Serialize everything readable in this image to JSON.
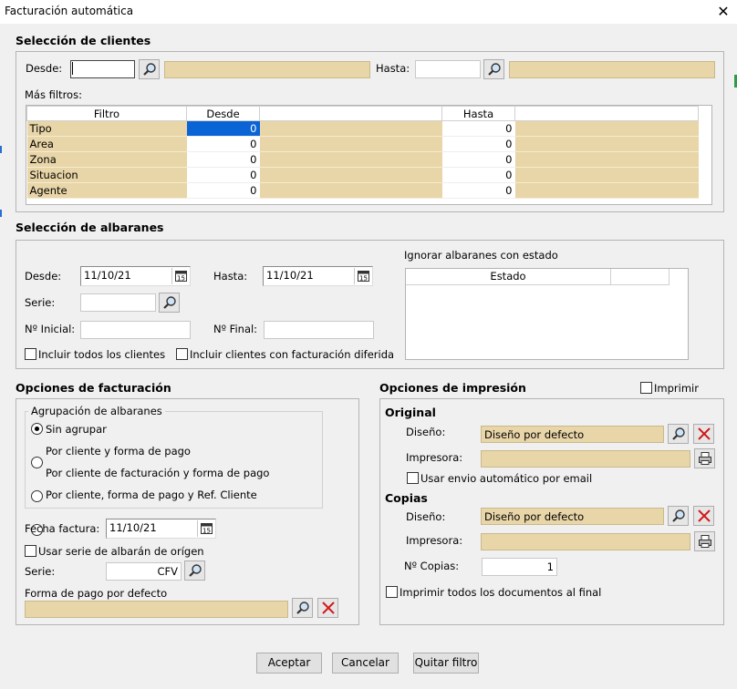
{
  "window": {
    "title": "Facturación automática",
    "close": "✕"
  },
  "clientes": {
    "title": "Selección de clientes",
    "desde_label": "Desde:",
    "hasta_label": "Hasta:",
    "desde_value": "",
    "hasta_value": "",
    "desde_name": "",
    "hasta_name": "",
    "mas_filtros": "Más filtros:",
    "columns": [
      "Filtro",
      "Desde",
      "",
      "Hasta",
      ""
    ],
    "rows": [
      {
        "filtro": "Tipo",
        "desde": "0",
        "hasta": "0"
      },
      {
        "filtro": "Area",
        "desde": "0",
        "hasta": "0"
      },
      {
        "filtro": "Zona",
        "desde": "0",
        "hasta": "0"
      },
      {
        "filtro": "Situacion",
        "desde": "0",
        "hasta": "0"
      },
      {
        "filtro": "Agente",
        "desde": "0",
        "hasta": "0"
      }
    ]
  },
  "albaranes": {
    "title": "Selección de albaranes",
    "desde_label": "Desde:",
    "desde_value": "11/10/21",
    "hasta_label": "Hasta:",
    "hasta_value": "11/10/21",
    "serie_label": "Serie:",
    "serie_value": "",
    "ninicial_label": "Nº Inicial:",
    "ninicial_value": "",
    "nfinal_label": "Nº Final:",
    "nfinal_value": "",
    "incluir_todos": "Incluir todos los clientes",
    "incluir_diferida": "Incluir clientes con facturación diferida",
    "ignorar_label": "Ignorar albaranes con estado",
    "estado_col": "Estado"
  },
  "facturacion": {
    "title": "Opciones de facturación",
    "agrupacion_label": "Agrupación de albaranes",
    "options": [
      "Sin agrupar",
      "Por cliente y forma de pago",
      "Por cliente de facturación y forma de pago",
      "Por cliente, forma de pago y Ref. Cliente"
    ],
    "selected_index": 0,
    "fecha_label": "Fecha factura:",
    "fecha_value": "11/10/21",
    "usar_serie": "Usar serie de albarán de orígen",
    "serie_label": "Serie:",
    "serie_value": "CFV",
    "forma_pago_label": "Forma de pago por defecto",
    "forma_pago_value": ""
  },
  "impresion": {
    "title": "Opciones de impresión",
    "imprimir": "Imprimir",
    "original_label": "Original",
    "copias_label": "Copias",
    "diseno_label": "Diseño:",
    "impresora_label": "Impresora:",
    "original_diseno": "Diseño por defecto",
    "original_impresora": "",
    "usar_envio": "Usar envio automático por email",
    "copias_diseno": "Diseño por defecto",
    "copias_impresora": "",
    "ncopias_label": "Nº Copias:",
    "ncopias_value": "1",
    "imprimir_todos": "Imprimir todos los documentos al final"
  },
  "footer": {
    "aceptar": "Aceptar",
    "cancelar": "Cancelar",
    "quitar_filtro": "Quitar filtro"
  },
  "colors": {
    "tan": "#e8d5a8",
    "selection": "#0a64d6",
    "delete": "#d21a1a"
  }
}
